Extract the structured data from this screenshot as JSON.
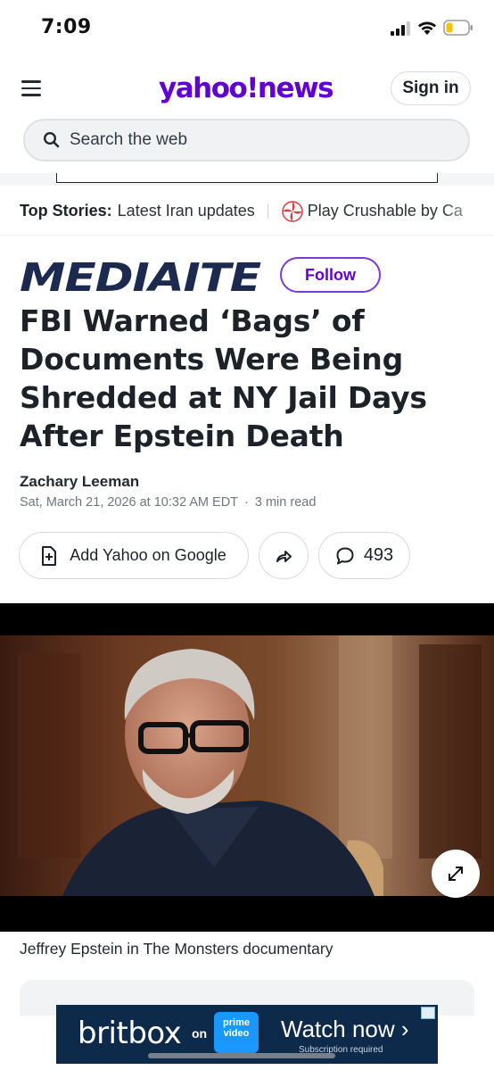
{
  "status_bar": {
    "time": "7:09"
  },
  "header": {
    "logo_text": "yahoo!news",
    "sign_in_label": "Sign in",
    "search_placeholder": "Search the web"
  },
  "top_stories": {
    "label": "Top Stories:",
    "link": "Latest Iran updates",
    "game_link": "Play Crushable by Ca"
  },
  "publisher": {
    "name": "MEDIAITE",
    "follow_label": "Follow"
  },
  "article": {
    "headline": "FBI Warned ‘Bags’ of Documents Were Being Shredded at NY Jail Days After Epstein Death",
    "author": "Zachary Leeman",
    "date": "Sat, March 21, 2026 at 10:32 AM EDT",
    "read_time": "3 min read",
    "separator": "·"
  },
  "actions": {
    "add_google_label": "Add Yahoo on Google",
    "comment_count": "493"
  },
  "media": {
    "caption": "Jeffrey Epstein in The Monsters documentary"
  },
  "ad": {
    "brand": "britbox",
    "on_text": "on",
    "prime_line1": "prime",
    "prime_line2": "video",
    "cta": "Watch now ›",
    "sub": "Subscription required"
  },
  "colors": {
    "yahoo_purple": "#6001d2",
    "mediaite_navy": "#1c2a4f",
    "mediaite_red": "#d4282f",
    "ad_background": "#0d2a4a"
  }
}
